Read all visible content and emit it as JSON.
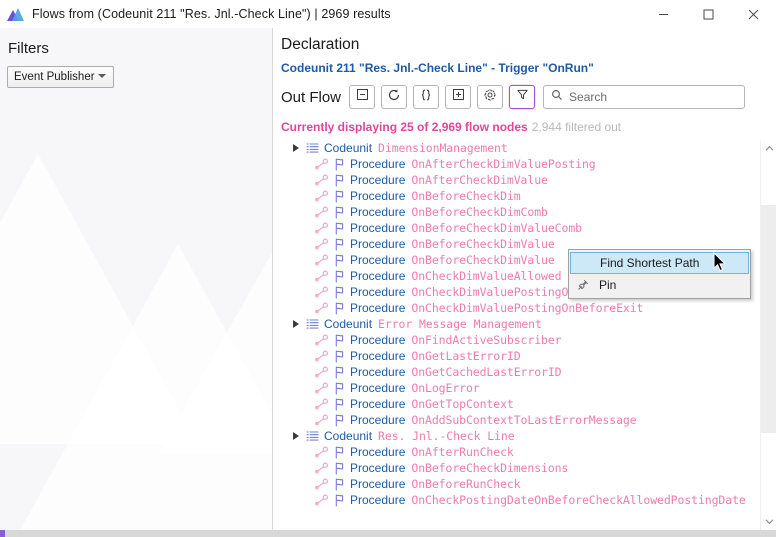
{
  "window": {
    "title": "Flows from (Codeunit 211 \"Res. Jnl.-Check Line\") | 2969 results",
    "app_icon": "mountain-triangle-icon",
    "minimize_label": "Minimize",
    "maximize_label": "Maximize",
    "close_label": "Close"
  },
  "sidebar": {
    "title": "Filters",
    "filter_select": {
      "value": "Event Publisher",
      "caret_icon": "chevron-down-icon"
    }
  },
  "main": {
    "title": "Declaration",
    "subtitle": "Codeunit 211 \"Res. Jnl.-Check Line\"  -  Trigger \"OnRun\"",
    "toolbar": {
      "label": "Out Flow",
      "buttons": [
        {
          "name": "collapse-all-button",
          "icon": "minus-box-icon",
          "active": false
        },
        {
          "name": "refresh-button",
          "icon": "refresh-cycle-icon",
          "active": false
        },
        {
          "name": "braces-button",
          "icon": "braces-icon",
          "active": false
        },
        {
          "name": "expand-all-button",
          "icon": "plus-box-icon",
          "active": false
        },
        {
          "name": "settings-button",
          "icon": "gear-icon",
          "active": false
        },
        {
          "name": "filter-button",
          "icon": "funnel-icon",
          "active": true
        }
      ],
      "search": {
        "placeholder": "Search",
        "value": "",
        "icon": "search-icon"
      }
    },
    "status": {
      "main": "Currently displaying 25 of 2,969 flow nodes",
      "dim": "2,944 filtered out"
    }
  },
  "tree": {
    "keyword_codeunit": "Codeunit",
    "keyword_procedure": "Procedure",
    "groups": [
      {
        "name": "DimensionManagement",
        "expander_icon": "expander-triangle-icon",
        "icon": "codeunit-list-icon",
        "children": [
          {
            "name": "OnAfterCheckDimValuePosting",
            "dim": false
          },
          {
            "name": "OnAfterCheckDimValue",
            "dim": false
          },
          {
            "name": "OnBeforeCheckDim",
            "dim": false
          },
          {
            "name": "OnBeforeCheckDimComb",
            "dim": false
          },
          {
            "name": "OnBeforeCheckDimValueComb",
            "dim": false
          },
          {
            "name": "OnBeforeCheckDimValue",
            "dim": false
          },
          {
            "name": "OnBeforeCheckDimValue",
            "dim": false
          },
          {
            "name": "OnCheckDimValueAllowed",
            "dim": false
          },
          {
            "name": "OnCheckDimValuePostingOnBeforeLogErrors",
            "dim": false
          },
          {
            "name": "OnCheckDimValuePostingOnBeforeExit",
            "dim": false
          }
        ]
      },
      {
        "name": "Error Message Management",
        "expander_icon": "expander-triangle-icon",
        "icon": "codeunit-list-icon",
        "children": [
          {
            "name": "OnFindActiveSubscriber",
            "dim": false
          },
          {
            "name": "OnGetLastErrorID",
            "dim": false
          },
          {
            "name": "OnGetCachedLastErrorID",
            "dim": false
          },
          {
            "name": "OnLogError",
            "dim": false
          },
          {
            "name": "OnGetTopContext",
            "dim": false
          },
          {
            "name": "OnAddSubContextToLastErrorMessage",
            "dim": false
          }
        ]
      },
      {
        "name": "Res. Jnl.-Check Line",
        "expander_icon": "expander-triangle-icon",
        "icon": "codeunit-list-icon",
        "children": [
          {
            "name": "OnAfterRunCheck",
            "dim": false
          },
          {
            "name": "OnBeforeCheckDimensions",
            "dim": false
          },
          {
            "name": "OnBeforeRunCheck",
            "dim": false
          },
          {
            "name": "OnCheckPostingDateOnBeforeCheckAllowedPostingDate",
            "dim": false
          }
        ]
      }
    ]
  },
  "context_menu": {
    "items": [
      {
        "label": "Find Shortest Path",
        "icon": null,
        "selected": true
      },
      {
        "label": "Pin",
        "icon": "pin-icon",
        "selected": false
      }
    ]
  },
  "scrollbars": {
    "vertical": {
      "up_icon": "chevron-up-icon",
      "down_icon": "chevron-down-icon"
    },
    "horizontal": {
      "accent": "#8b5ed8"
    }
  },
  "colors": {
    "accent_pink": "#e0459b",
    "keyword_blue": "#1f5aa6",
    "identifier_pink": "#f07ab0",
    "filter_purple": "#a64fd8"
  }
}
